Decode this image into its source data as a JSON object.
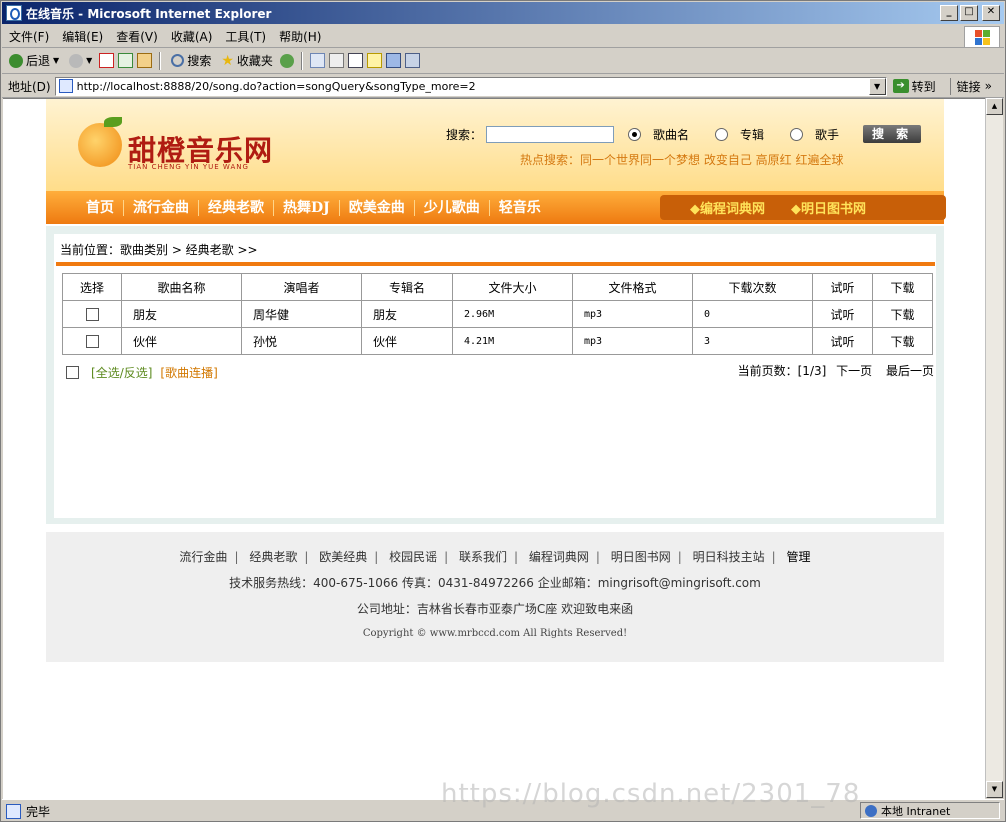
{
  "window": {
    "title": "在线音乐 - Microsoft Internet Explorer",
    "controls": [
      "_",
      "□",
      "✕"
    ]
  },
  "menu": [
    "文件(F)",
    "编辑(E)",
    "查看(V)",
    "收藏(A)",
    "工具(T)",
    "帮助(H)"
  ],
  "toolbar": {
    "back": "后退",
    "search": "搜索",
    "favorites": "收藏夹"
  },
  "address": {
    "label": "地址(D)",
    "url": "http://localhost:8888/20/song.do?action=songQuery&songType_more=2",
    "go": "转到",
    "links": "链接"
  },
  "site": {
    "logo_text": "甜橙音乐网",
    "logo_pinyin": "TIAN CHENG YIN YUE WANG",
    "search_label": "搜索：",
    "search_value": "",
    "radios": [
      {
        "label": "歌曲名",
        "checked": true
      },
      {
        "label": "专辑",
        "checked": false
      },
      {
        "label": "歌手",
        "checked": false
      }
    ],
    "search_button": "搜 索",
    "hot_label": "热点搜索：",
    "hot_items": "同一个世界同一个梦想 改变自己 高原红 红遍全球",
    "nav": [
      "首页",
      "流行金曲",
      "经典老歌",
      "热舞DJ",
      "欧美金曲",
      "少儿歌曲",
      "轻音乐"
    ],
    "nav_links": [
      "◆编程词典网",
      "◆明日图书网"
    ],
    "breadcrumb": "当前位置：歌曲类别 > 经典老歌 >>",
    "table": {
      "headers": [
        "选择",
        "歌曲名称",
        "演唱者",
        "专辑名",
        "文件大小",
        "文件格式",
        "下载次数",
        "试听",
        "下载"
      ],
      "rows": [
        {
          "name": "朋友",
          "singer": "周华健",
          "album": "朋友",
          "size": "2.96M",
          "format": "mp3",
          "downloads": "0",
          "listen": "试听",
          "download": "下载"
        },
        {
          "name": "伙伴",
          "singer": "孙悦",
          "album": "伙伴",
          "size": "4.21M",
          "format": "mp3",
          "downloads": "3",
          "listen": "试听",
          "download": "下载"
        }
      ]
    },
    "select_all": "全选/反选",
    "play_continuous": "歌曲连播",
    "pager": {
      "label": "当前页数：[1/3]",
      "next": "下一页",
      "last": "最后一页"
    },
    "footer": {
      "links": [
        "流行金曲",
        "经典老歌",
        "欧美经典",
        "校园民谣",
        "联系我们",
        "编程词典网",
        "明日图书网",
        "明日科技主站",
        "管理"
      ],
      "contact": "技术服务热线：400-675-1066 传真：0431-84972266 企业邮箱：mingrisoft@mingrisoft.com",
      "address": "公司地址：吉林省长春市亚泰广场C座 欢迎致电来函",
      "copyright": "Copyright © www.mrbccd.com All Rights Reserved!"
    }
  },
  "status": {
    "text": "完毕",
    "zone": "本地 Intranet",
    "watermark": "https://blog.csdn.net/2301_78"
  }
}
